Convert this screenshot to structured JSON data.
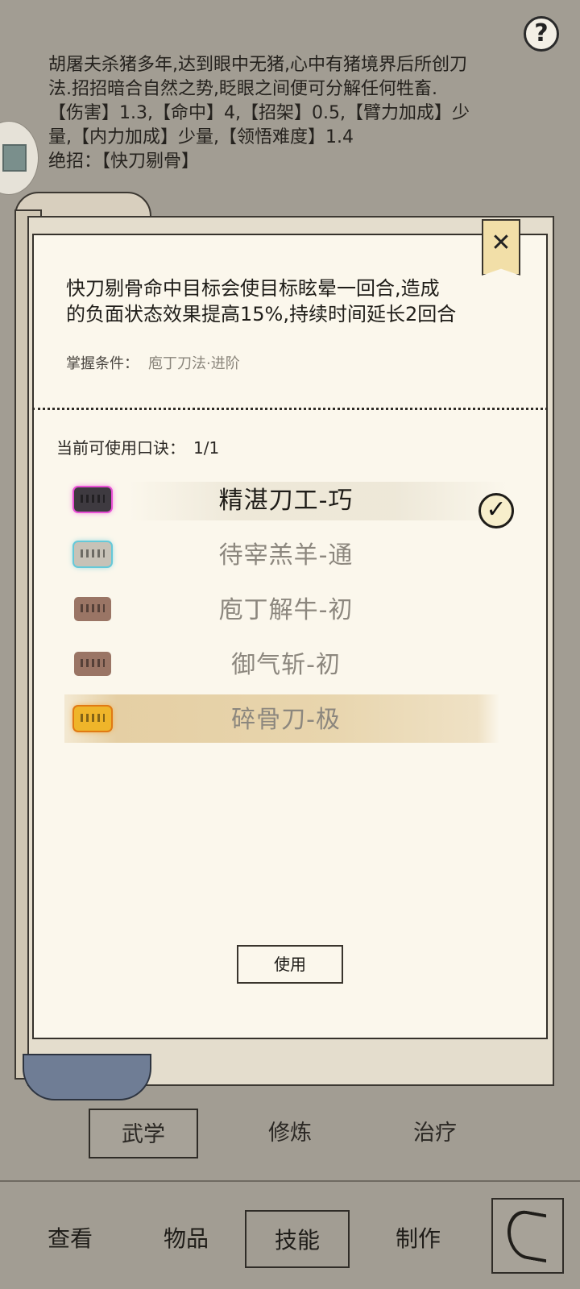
{
  "help": {
    "label": "?"
  },
  "description": {
    "line1": "胡屠夫杀猪多年,达到眼中无猪,心中有猪境界后所创刀",
    "line2": "法.招招暗合自然之势,眨眼之间便可分解任何牲畜.",
    "line3": "【伤害】1.3,【命中】4,【招架】0.5,【臂力加成】少",
    "line4": "量,【内力加成】少量,【领悟难度】1.4",
    "line5": "绝招：【快刀剔骨】"
  },
  "modal": {
    "close_label": "✕",
    "skill_desc_line1": "快刀剔骨命中目标会使目标眩晕一回合,造成",
    "skill_desc_line2": "的负面状态效果提高15%,持续时间延长2回合",
    "condition_label": "掌握条件：",
    "condition_value": "庖丁刀法·进阶",
    "slots_label": "当前可使用口诀：",
    "slots_value": "1/1",
    "techniques": [
      {
        "name": "精湛刀工-巧",
        "selected": true
      },
      {
        "name": "待宰羔羊-通",
        "selected": false
      },
      {
        "name": "庖丁解牛-初",
        "selected": false
      },
      {
        "name": "御气斩-初",
        "selected": false
      },
      {
        "name": "碎骨刀-极",
        "selected": false
      }
    ],
    "check_icon": "✓",
    "use_button": "使用"
  },
  "subtabs": [
    "武学",
    "修炼",
    "治疗"
  ],
  "nav": [
    "查看",
    "物品",
    "技能",
    "制作"
  ]
}
